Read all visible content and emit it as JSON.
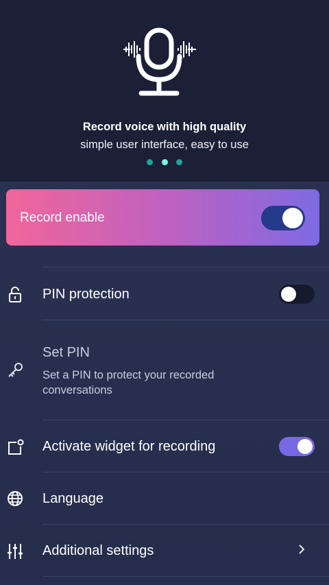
{
  "hero": {
    "title": "Record voice with high quality",
    "subtitle": "simple user interface, easy to use",
    "pager": {
      "count": 3,
      "active_index": 1
    }
  },
  "record_card": {
    "label": "Record enable",
    "enabled": true,
    "gradient": [
      "#f1669a",
      "#c061c0",
      "#7f6ae3"
    ]
  },
  "settings": {
    "pin_protection": {
      "label": "PIN protection",
      "enabled": false,
      "icon": "unlock-icon"
    },
    "set_pin": {
      "label": "Set PIN",
      "description": "Set a PIN to protect your recorded conversations",
      "icon": "key-icon"
    },
    "widget": {
      "label": "Activate widget for recording",
      "enabled": true,
      "icon": "widget-icon"
    },
    "language": {
      "label": "Language",
      "icon": "globe-icon"
    },
    "additional": {
      "label": "Additional settings",
      "icon": "sliders-icon"
    }
  },
  "colors": {
    "hero_bg": "#1b2037",
    "content_bg": "#273050",
    "accent_purple": "#7968e3",
    "toggle_on_blue": "#253a8a",
    "pager_active": "#7ff2ea",
    "pager_inactive": "#1fa39a"
  }
}
